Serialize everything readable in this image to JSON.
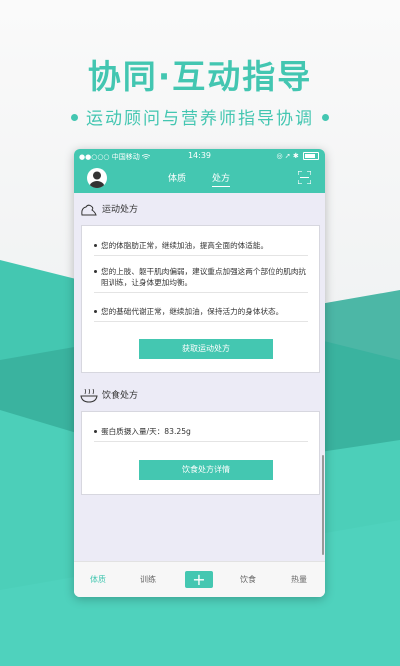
{
  "promo": {
    "headline": "协同·互动指导",
    "subline": "运动顾问与营养师指导协调",
    "accent_color": "#43c6b1"
  },
  "status_bar": {
    "carrier": "●●○○○ 中国移动",
    "wifi_icon": "wifi-icon",
    "time": "14:39",
    "right_icons": "◎ ➚ ✱"
  },
  "header": {
    "avatar_icon": "user-avatar-icon",
    "tabs": [
      {
        "label": "体质",
        "active": false
      },
      {
        "label": "处方",
        "active": true
      }
    ],
    "scan_icon": "scan-icon"
  },
  "exercise": {
    "title": "运动处方",
    "icon": "muscle-arm-icon",
    "items": [
      "您的体脂肪正常，继续加油，提高全面的体适能。",
      "您的上肢、躯干肌肉偏弱，建议重点加强这两个部位的肌肉抗阻训练，让身体更加均衡。",
      "您的基础代谢正常，继续加油，保持活力的身体状态。"
    ],
    "button_label": "获取运动处方"
  },
  "diet": {
    "title": "饮食处方",
    "icon": "food-bowl-icon",
    "items": [
      "蛋白质摄入量/天：83.25g"
    ],
    "button_label": "饮食处方详情"
  },
  "tabbar": {
    "items": [
      {
        "label": "体质",
        "active": true
      },
      {
        "label": "训练",
        "active": false
      },
      {
        "label": "+",
        "active": false
      },
      {
        "label": "饮食",
        "active": false
      },
      {
        "label": "热量",
        "active": false
      }
    ]
  }
}
